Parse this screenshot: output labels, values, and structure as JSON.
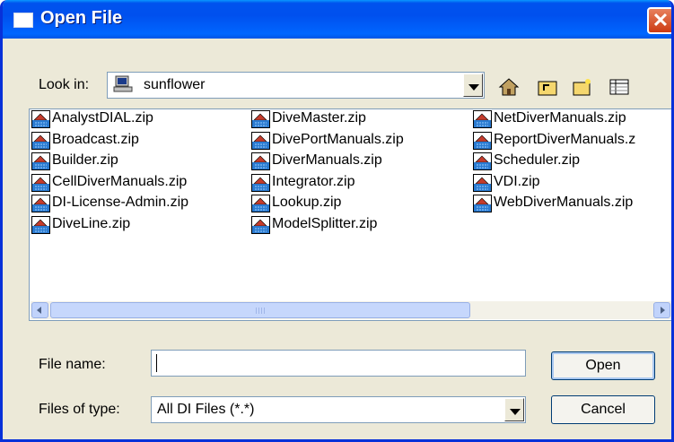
{
  "window": {
    "title": "Open File",
    "close_glyph": "✕"
  },
  "lookin": {
    "label": "Look in:",
    "value": "sunflower",
    "icon": "computer-icon"
  },
  "toolbar": {
    "icons": [
      "back-home-icon",
      "up-folder-icon",
      "new-folder-icon",
      "details-view-icon"
    ]
  },
  "files": [
    [
      "AnalystDIAL.zip",
      "Broadcast.zip",
      "Builder.zip",
      "CellDiverManuals.zip",
      "DI-License-Admin.zip",
      "DiveLine.zip"
    ],
    [
      "DiveMaster.zip",
      "DivePortManuals.zip",
      "DiverManuals.zip",
      "Integrator.zip",
      "Lookup.zip",
      "ModelSplitter.zip"
    ],
    [
      "NetDiverManuals.zip",
      "ReportDiverManuals.z",
      "Scheduler.zip",
      "VDI.zip",
      "WebDiverManuals.zip"
    ]
  ],
  "filename": {
    "label": "File name:",
    "value": ""
  },
  "filetype": {
    "label": "Files of type:",
    "value": "All DI Files (*.*)"
  },
  "buttons": {
    "open": "Open",
    "cancel": "Cancel"
  },
  "colors": {
    "titlebar": "#0053ee",
    "face": "#ece9d8",
    "border": "#7f9db9"
  }
}
